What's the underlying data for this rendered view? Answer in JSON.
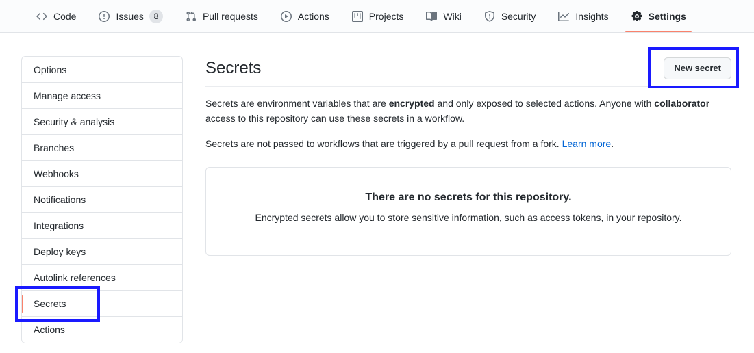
{
  "theme": {
    "accent": "#f9826c",
    "link": "#0366d6",
    "annotation": "#1a1aff",
    "border": "#e1e4e8"
  },
  "repo_nav": {
    "items": [
      {
        "label": "Code",
        "icon": "code-icon",
        "active": false,
        "count": null
      },
      {
        "label": "Issues",
        "icon": "issue-opened-icon",
        "active": false,
        "count": "8"
      },
      {
        "label": "Pull requests",
        "icon": "git-pull-request-icon",
        "active": false,
        "count": null
      },
      {
        "label": "Actions",
        "icon": "play-icon",
        "active": false,
        "count": null
      },
      {
        "label": "Projects",
        "icon": "project-icon",
        "active": false,
        "count": null
      },
      {
        "label": "Wiki",
        "icon": "book-icon",
        "active": false,
        "count": null
      },
      {
        "label": "Security",
        "icon": "shield-icon",
        "active": false,
        "count": null
      },
      {
        "label": "Insights",
        "icon": "graph-icon",
        "active": false,
        "count": null
      },
      {
        "label": "Settings",
        "icon": "gear-icon",
        "active": true,
        "count": null
      }
    ]
  },
  "sidebar": {
    "items": [
      {
        "label": "Options",
        "selected": false
      },
      {
        "label": "Manage access",
        "selected": false
      },
      {
        "label": "Security & analysis",
        "selected": false
      },
      {
        "label": "Branches",
        "selected": false
      },
      {
        "label": "Webhooks",
        "selected": false
      },
      {
        "label": "Notifications",
        "selected": false
      },
      {
        "label": "Integrations",
        "selected": false
      },
      {
        "label": "Deploy keys",
        "selected": false
      },
      {
        "label": "Autolink references",
        "selected": false
      },
      {
        "label": "Secrets",
        "selected": true
      },
      {
        "label": "Actions",
        "selected": false
      }
    ]
  },
  "main": {
    "title": "Secrets",
    "new_secret_button": "New secret",
    "paragraph1": {
      "part1": "Secrets are environment variables that are ",
      "bold1": "encrypted",
      "part2": " and only exposed to selected actions. Anyone with ",
      "bold2": "collaborator",
      "part3": " access to this repository can use these secrets in a workflow."
    },
    "paragraph2": {
      "part1": "Secrets are not passed to workflows that are triggered by a pull request from a fork. ",
      "link": "Learn more",
      "part2": "."
    },
    "empty_state": {
      "title": "There are no secrets for this repository.",
      "subtitle": "Encrypted secrets allow you to store sensitive information, such as access tokens, in your repository."
    }
  },
  "annotations": [
    {
      "name": "new-secret-highlight",
      "target": "New secret"
    },
    {
      "name": "secrets-sidebar-highlight",
      "target": "Secrets"
    }
  ]
}
